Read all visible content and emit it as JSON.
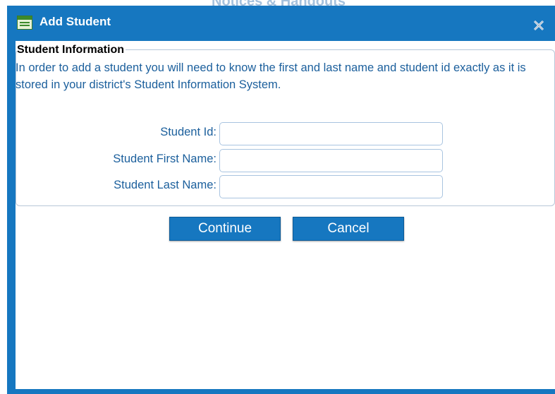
{
  "background": {
    "partial_title": "Notices & Handouts"
  },
  "dialog": {
    "title": "Add Student",
    "title_icon": "form-icon",
    "close_icon": "close-icon",
    "accent_color": "#1677c0"
  },
  "section": {
    "legend": "Student Information",
    "description": "In order to add a student you will need to know the first and last name and student id exactly as it is stored in your district's Student Information System."
  },
  "form": {
    "fields": [
      {
        "label": "Student Id:",
        "value": "",
        "placeholder": ""
      },
      {
        "label": "Student First Name:",
        "value": "",
        "placeholder": ""
      },
      {
        "label": "Student Last Name:",
        "value": "",
        "placeholder": ""
      }
    ]
  },
  "buttons": {
    "continue_label": "Continue",
    "cancel_label": "Cancel"
  }
}
